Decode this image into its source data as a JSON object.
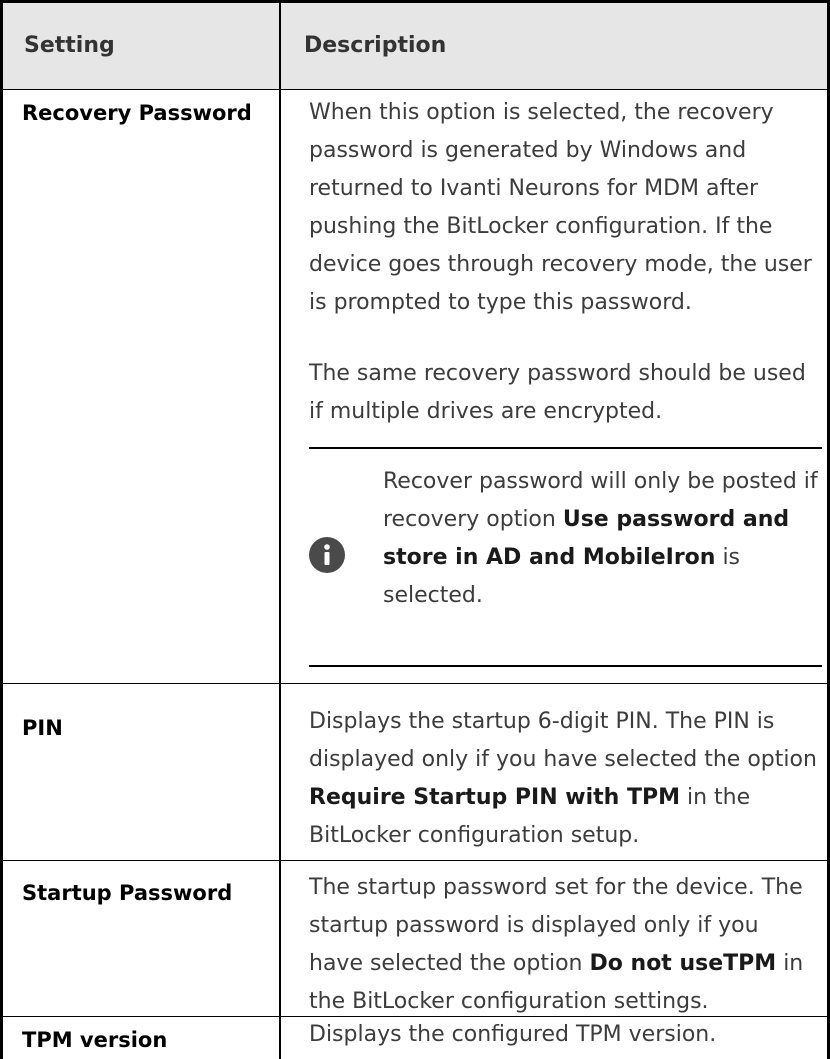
{
  "header": {
    "setting": "Setting",
    "description": "Description"
  },
  "rows": [
    {
      "setting": "Recovery Password",
      "desc_p1": "When this option is selected, the recovery password is generated by Windows and returned to Ivanti Neurons for MDM after pushing the BitLocker configuration. If the device goes through recovery mode, the user is prompted to type this password.",
      "desc_p2": "The same recovery password should be used if multiple drives are encrypted.",
      "note": {
        "icon": "info-icon",
        "text_pre": "Recover password will only be posted if recovery option ",
        "text_bold": "Use password and store in AD and MobileIron",
        "text_post": " is selected."
      }
    },
    {
      "setting": "PIN",
      "desc_pre": "Displays the startup 6-digit PIN. The PIN is displayed only if you have selected the option ",
      "desc_bold": "Require Startup PIN with TPM",
      "desc_post": " in the BitLocker configuration setup."
    },
    {
      "setting": "Startup Password",
      "desc_pre": "The startup password set for the device. The startup password is displayed only if you have selected the option ",
      "desc_bold": "Do not useTPM",
      "desc_post": " in the BitLocker configuration settings."
    },
    {
      "setting": "TPM version",
      "desc": "Displays the configured TPM version."
    }
  ],
  "colors": {
    "header_bg": "#e6e6e6",
    "border": "#000000",
    "text": "#3c3c3c",
    "icon": "#4a4a4a"
  }
}
